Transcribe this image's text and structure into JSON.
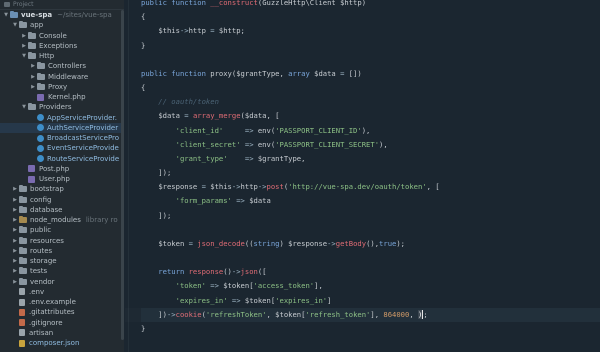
{
  "sidebar": {
    "header": "Project",
    "root": {
      "name": "vue-spa",
      "path": "~/sites/vue-spa"
    },
    "items": [
      {
        "label": "app",
        "depth": 1,
        "type": "folder-open",
        "icon": "folder-icon"
      },
      {
        "label": "Console",
        "depth": 2,
        "type": "folder-closed",
        "icon": "folder-icon"
      },
      {
        "label": "Exceptions",
        "depth": 2,
        "type": "folder-closed",
        "icon": "folder-icon"
      },
      {
        "label": "Http",
        "depth": 2,
        "type": "folder-open",
        "icon": "folder-icon"
      },
      {
        "label": "Controllers",
        "depth": 3,
        "type": "folder-closed",
        "icon": "folder-icon"
      },
      {
        "label": "Middleware",
        "depth": 3,
        "type": "folder-closed",
        "icon": "folder-icon"
      },
      {
        "label": "Proxy",
        "depth": 3,
        "type": "folder-closed",
        "icon": "folder-icon"
      },
      {
        "label": "Kernel.php",
        "depth": 3,
        "type": "php",
        "icon": "php-file-icon"
      },
      {
        "label": "Providers",
        "depth": 2,
        "type": "folder-open",
        "icon": "folder-icon"
      },
      {
        "label": "AppServiceProvider.",
        "depth": 3,
        "type": "class",
        "icon": "class-icon"
      },
      {
        "label": "AuthServiceProvider",
        "depth": 3,
        "type": "class",
        "icon": "class-icon",
        "selected": true
      },
      {
        "label": "BroadcastServicePro",
        "depth": 3,
        "type": "class",
        "icon": "class-icon"
      },
      {
        "label": "EventServiceProvide",
        "depth": 3,
        "type": "class",
        "icon": "class-icon"
      },
      {
        "label": "RouteServiceProvide",
        "depth": 3,
        "type": "class",
        "icon": "class-icon"
      },
      {
        "label": "Post.php",
        "depth": 2,
        "type": "php",
        "icon": "php-file-icon"
      },
      {
        "label": "User.php",
        "depth": 2,
        "type": "php",
        "icon": "php-file-icon"
      },
      {
        "label": "bootstrap",
        "depth": 1,
        "type": "folder-closed",
        "icon": "folder-icon"
      },
      {
        "label": "config",
        "depth": 1,
        "type": "folder-closed",
        "icon": "folder-icon"
      },
      {
        "label": "database",
        "depth": 1,
        "type": "folder-closed",
        "icon": "folder-icon"
      },
      {
        "label": "node_modules",
        "depth": 1,
        "type": "folder-excluded",
        "icon": "folder-icon",
        "note": "library ro"
      },
      {
        "label": "public",
        "depth": 1,
        "type": "folder-closed",
        "icon": "folder-icon"
      },
      {
        "label": "resources",
        "depth": 1,
        "type": "folder-closed",
        "icon": "folder-icon"
      },
      {
        "label": "routes",
        "depth": 1,
        "type": "folder-closed",
        "icon": "folder-icon"
      },
      {
        "label": "storage",
        "depth": 1,
        "type": "folder-closed",
        "icon": "folder-icon"
      },
      {
        "label": "tests",
        "depth": 1,
        "type": "folder-closed",
        "icon": "folder-icon"
      },
      {
        "label": "vendor",
        "depth": 1,
        "type": "folder-closed",
        "icon": "folder-icon"
      },
      {
        "label": ".env",
        "depth": 1,
        "type": "file",
        "icon": "file-icon"
      },
      {
        "label": ".env.example",
        "depth": 1,
        "type": "file",
        "icon": "file-icon"
      },
      {
        "label": ".gitattributes",
        "depth": 1,
        "type": "git",
        "icon": "git-file-icon"
      },
      {
        "label": ".gitignore",
        "depth": 1,
        "type": "git",
        "icon": "git-file-icon"
      },
      {
        "label": "artisan",
        "depth": 1,
        "type": "file",
        "icon": "file-icon"
      },
      {
        "label": "composer.json",
        "depth": 1,
        "type": "json",
        "icon": "json-file-icon"
      }
    ]
  },
  "editor": {
    "current_line": 22,
    "lines": [
      [
        [
          "k",
          "public function "
        ],
        [
          "f",
          "__construct"
        ],
        [
          "p",
          "("
        ],
        [
          "v",
          "GuzzleHttp\\Client $http"
        ],
        [
          "p",
          ")"
        ]
      ],
      [
        [
          "p",
          "{"
        ]
      ],
      [
        [
          "p",
          "    "
        ],
        [
          "v",
          "$this"
        ],
        [
          "o",
          "->"
        ],
        [
          "v",
          "http"
        ],
        [
          "o",
          " = "
        ],
        [
          "v",
          "$http"
        ],
        [
          "p",
          ";"
        ]
      ],
      [
        [
          "p",
          "}"
        ]
      ],
      [],
      [
        [
          "k",
          "public function "
        ],
        [
          "v",
          "proxy"
        ],
        [
          "p",
          "("
        ],
        [
          "v",
          "$grantType"
        ],
        [
          "p",
          ", "
        ],
        [
          "k",
          "array "
        ],
        [
          "v",
          "$data"
        ],
        [
          "o",
          " = "
        ],
        [
          "p",
          "[])"
        ]
      ],
      [
        [
          "p",
          "{"
        ]
      ],
      [
        [
          "c",
          "    // oauth/token"
        ]
      ],
      [
        [
          "p",
          "    "
        ],
        [
          "v",
          "$data"
        ],
        [
          "o",
          " = "
        ],
        [
          "f",
          "array_merge"
        ],
        [
          "p",
          "("
        ],
        [
          "v",
          "$data"
        ],
        [
          "p",
          ", ["
        ]
      ],
      [
        [
          "p",
          "        "
        ],
        [
          "s",
          "'client_id'"
        ],
        [
          "o",
          "     => "
        ],
        [
          "v",
          "env"
        ],
        [
          "p",
          "("
        ],
        [
          "s",
          "'PASSPORT_CLIENT_ID'"
        ],
        [
          "p",
          "),"
        ]
      ],
      [
        [
          "p",
          "        "
        ],
        [
          "s",
          "'client_secret'"
        ],
        [
          "o",
          " => "
        ],
        [
          "v",
          "env"
        ],
        [
          "p",
          "("
        ],
        [
          "s",
          "'PASSPORT_CLIENT_SECRET'"
        ],
        [
          "p",
          "),"
        ]
      ],
      [
        [
          "p",
          "        "
        ],
        [
          "s",
          "'grant_type'"
        ],
        [
          "o",
          "    => "
        ],
        [
          "v",
          "$grantType"
        ],
        [
          "p",
          ","
        ]
      ],
      [
        [
          "p",
          "    ]);"
        ]
      ],
      [
        [
          "p",
          "    "
        ],
        [
          "v",
          "$response"
        ],
        [
          "o",
          " = "
        ],
        [
          "v",
          "$this"
        ],
        [
          "o",
          "->"
        ],
        [
          "v",
          "http"
        ],
        [
          "o",
          "->"
        ],
        [
          "f",
          "post"
        ],
        [
          "p",
          "("
        ],
        [
          "s",
          "'http://vue-spa.dev/oauth/token'"
        ],
        [
          "p",
          ", ["
        ]
      ],
      [
        [
          "p",
          "        "
        ],
        [
          "s",
          "'form_params'"
        ],
        [
          "o",
          " => "
        ],
        [
          "v",
          "$data"
        ]
      ],
      [
        [
          "p",
          "    ]);"
        ]
      ],
      [],
      [
        [
          "p",
          "    "
        ],
        [
          "v",
          "$token"
        ],
        [
          "o",
          " = "
        ],
        [
          "f",
          "json_decode"
        ],
        [
          "p",
          "(("
        ],
        [
          "k",
          "string"
        ],
        [
          "p",
          ") "
        ],
        [
          "v",
          "$response"
        ],
        [
          "o",
          "->"
        ],
        [
          "f",
          "getBody"
        ],
        [
          "p",
          "(),"
        ],
        [
          "k",
          "true"
        ],
        [
          "p",
          ");"
        ]
      ],
      [],
      [
        [
          "k",
          "    return "
        ],
        [
          "f",
          "response"
        ],
        [
          "p",
          "()"
        ],
        [
          "o",
          "->"
        ],
        [
          "f",
          "json"
        ],
        [
          "p",
          "(["
        ]
      ],
      [
        [
          "p",
          "        "
        ],
        [
          "s",
          "'token'"
        ],
        [
          "o",
          " => "
        ],
        [
          "v",
          "$token"
        ],
        [
          "p",
          "["
        ],
        [
          "s",
          "'access_token'"
        ],
        [
          "p",
          "],"
        ]
      ],
      [
        [
          "p",
          "        "
        ],
        [
          "s",
          "'expires_in'"
        ],
        [
          "o",
          " => "
        ],
        [
          "v",
          "$token"
        ],
        [
          "p",
          "["
        ],
        [
          "s",
          "'expires_in'"
        ],
        [
          "p",
          "]"
        ]
      ],
      [
        [
          "p",
          "    ])"
        ],
        [
          "o",
          "->"
        ],
        [
          "f",
          "cookie"
        ],
        [
          "p",
          "("
        ],
        [
          "s",
          "'refreshToken'"
        ],
        [
          "p",
          ", "
        ],
        [
          "v",
          "$token"
        ],
        [
          "p",
          "["
        ],
        [
          "s",
          "'refresh_token'"
        ],
        [
          "p",
          "], "
        ],
        [
          "n",
          "864000"
        ],
        [
          "p",
          ", "
        ],
        [
          "bh",
          ")"
        ],
        [
          "p",
          ";"
        ]
      ],
      [
        [
          "p",
          "}"
        ]
      ],
      [],
      [
        [
          "p",
          "}"
        ]
      ]
    ]
  },
  "colors": {
    "sidebar_bg": "#232b31",
    "editor_bg": "#1b2630",
    "keyword": "#7aa6da",
    "function": "#e06c75",
    "string": "#8cc085",
    "number": "#d19a66",
    "comment": "#4b6375",
    "selection": "#26384a"
  }
}
